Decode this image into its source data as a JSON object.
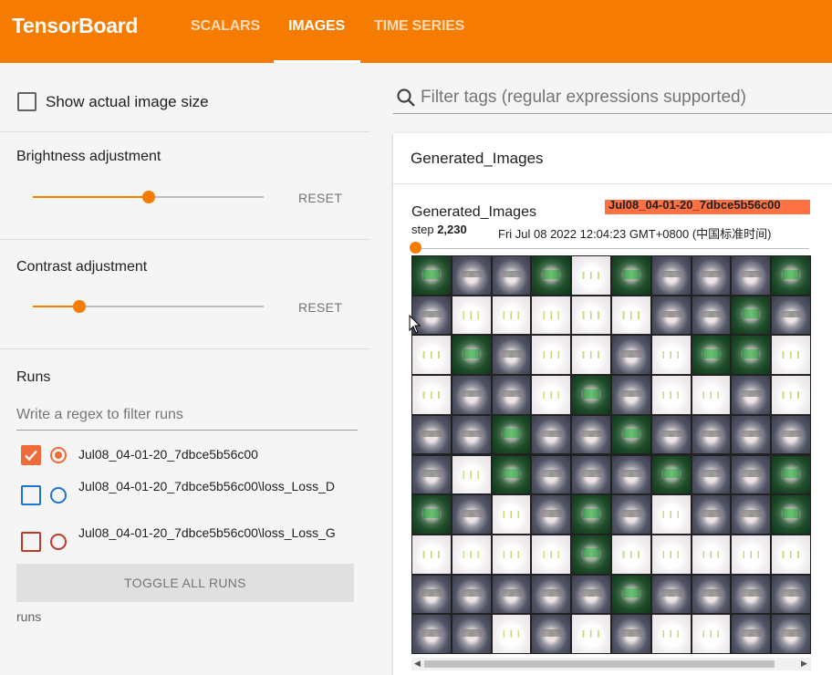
{
  "app": {
    "title": "TensorBoard"
  },
  "tabs": [
    {
      "label": "SCALARS",
      "active": false
    },
    {
      "label": "IMAGES",
      "active": true
    },
    {
      "label": "TIME SERIES",
      "active": false
    }
  ],
  "colors": {
    "accent": "#f57c00",
    "badge": "#ff7043"
  },
  "sidebar": {
    "show_actual_size": {
      "label": "Show actual image size",
      "checked": false
    },
    "brightness": {
      "title": "Brightness adjustment",
      "reset_label": "RESET",
      "value": 0.5
    },
    "contrast": {
      "title": "Contrast adjustment",
      "reset_label": "RESET",
      "value": 0.2
    },
    "runs": {
      "title": "Runs",
      "filter_placeholder": "Write a regex to filter runs",
      "items": [
        {
          "label": "Jul08_04-01-20_7dbce5b56c00",
          "checked": true,
          "color": "#ef6c3a"
        },
        {
          "label": "Jul08_04-01-20_7dbce5b56c00\\loss_Loss_D",
          "checked": false,
          "color": "#1976d2"
        },
        {
          "label": "Jul08_04-01-20_7dbce5b56c00\\loss_Loss_G",
          "checked": false,
          "color": "#c0392b"
        }
      ],
      "toggle_label": "TOGGLE ALL RUNS",
      "footer": "runs"
    }
  },
  "main": {
    "tag_filter_placeholder": "Filter tags (regular expressions supported)",
    "card": {
      "title": "Generated_Images",
      "image": {
        "title": "Generated_Images",
        "run_badge": "Jul08_04-01-20_7dbce5b56c00",
        "step_prefix": "step",
        "step_value": "2,230",
        "timestamp": "Fri Jul 08 2022 12:04:23 GMT+0800 (中国标准时间)",
        "grid_cells": [
          "dark",
          "grey",
          "grey",
          "dark",
          "light",
          "dark",
          "grey",
          "grey",
          "grey",
          "dark",
          "grey",
          "light",
          "light",
          "light",
          "light",
          "light",
          "grey",
          "grey",
          "dark",
          "grey",
          "light",
          "dark",
          "grey",
          "light",
          "light",
          "grey",
          "light",
          "dark",
          "dark",
          "light",
          "light",
          "grey",
          "grey",
          "light",
          "dark",
          "grey",
          "light",
          "light",
          "grey",
          "light",
          "grey",
          "grey",
          "dark",
          "grey",
          "grey",
          "dark",
          "grey",
          "grey",
          "grey",
          "grey",
          "grey",
          "light",
          "dark",
          "grey",
          "grey",
          "grey",
          "dark",
          "grey",
          "grey",
          "dark",
          "dark",
          "grey",
          "light",
          "grey",
          "dark",
          "grey",
          "light",
          "grey",
          "grey",
          "dark",
          "light",
          "light",
          "light",
          "light",
          "dark",
          "light",
          "light",
          "light",
          "light",
          "light",
          "grey",
          "grey",
          "grey",
          "grey",
          "grey",
          "dark",
          "grey",
          "grey",
          "grey",
          "grey",
          "grey",
          "grey",
          "light",
          "grey",
          "light",
          "grey",
          "light",
          "light",
          "grey",
          "grey"
        ]
      }
    }
  }
}
